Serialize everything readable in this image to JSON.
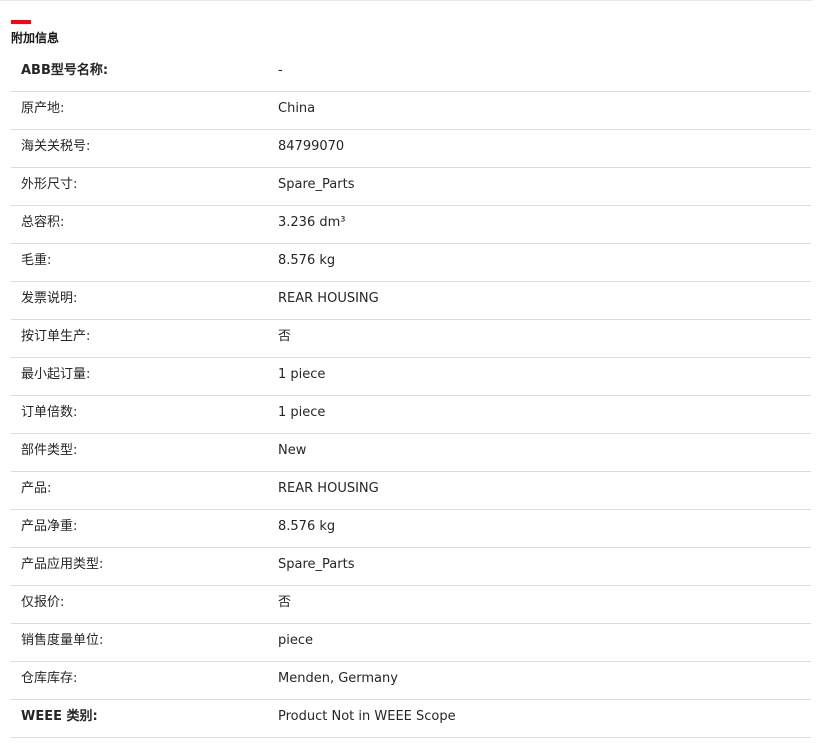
{
  "colors": {
    "accent": "#ff000f",
    "text": "#262626",
    "divider": "#dcdcdc"
  },
  "section": {
    "title": "附加信息"
  },
  "rows": [
    {
      "label": "ABB型号名称:",
      "value": "-",
      "bold": true
    },
    {
      "label": "原产地:",
      "value": "China"
    },
    {
      "label": "海关关税号:",
      "value": "84799070"
    },
    {
      "label": "外形尺寸:",
      "value": "Spare_Parts"
    },
    {
      "label": "总容积:",
      "value": "3.236 dm³"
    },
    {
      "label": "毛重:",
      "value": "8.576 kg"
    },
    {
      "label": "发票说明:",
      "value": "REAR HOUSING"
    },
    {
      "label": "按订单生产:",
      "value": "否"
    },
    {
      "label": "最小起订量:",
      "value": "1 piece"
    },
    {
      "label": "订单倍数:",
      "value": "1 piece"
    },
    {
      "label": "部件类型:",
      "value": "New"
    },
    {
      "label": "产品:",
      "value": "REAR HOUSING"
    },
    {
      "label": "产品净重:",
      "value": "8.576 kg"
    },
    {
      "label": "产品应用类型:",
      "value": "Spare_Parts"
    },
    {
      "label": "仅报价:",
      "value": "否"
    },
    {
      "label": "销售度量单位:",
      "value": "piece"
    },
    {
      "label": "仓库库存:",
      "value": "Menden, Germany"
    },
    {
      "label": "WEEE 类别:",
      "value": "Product Not in WEEE Scope",
      "bold": true
    }
  ]
}
